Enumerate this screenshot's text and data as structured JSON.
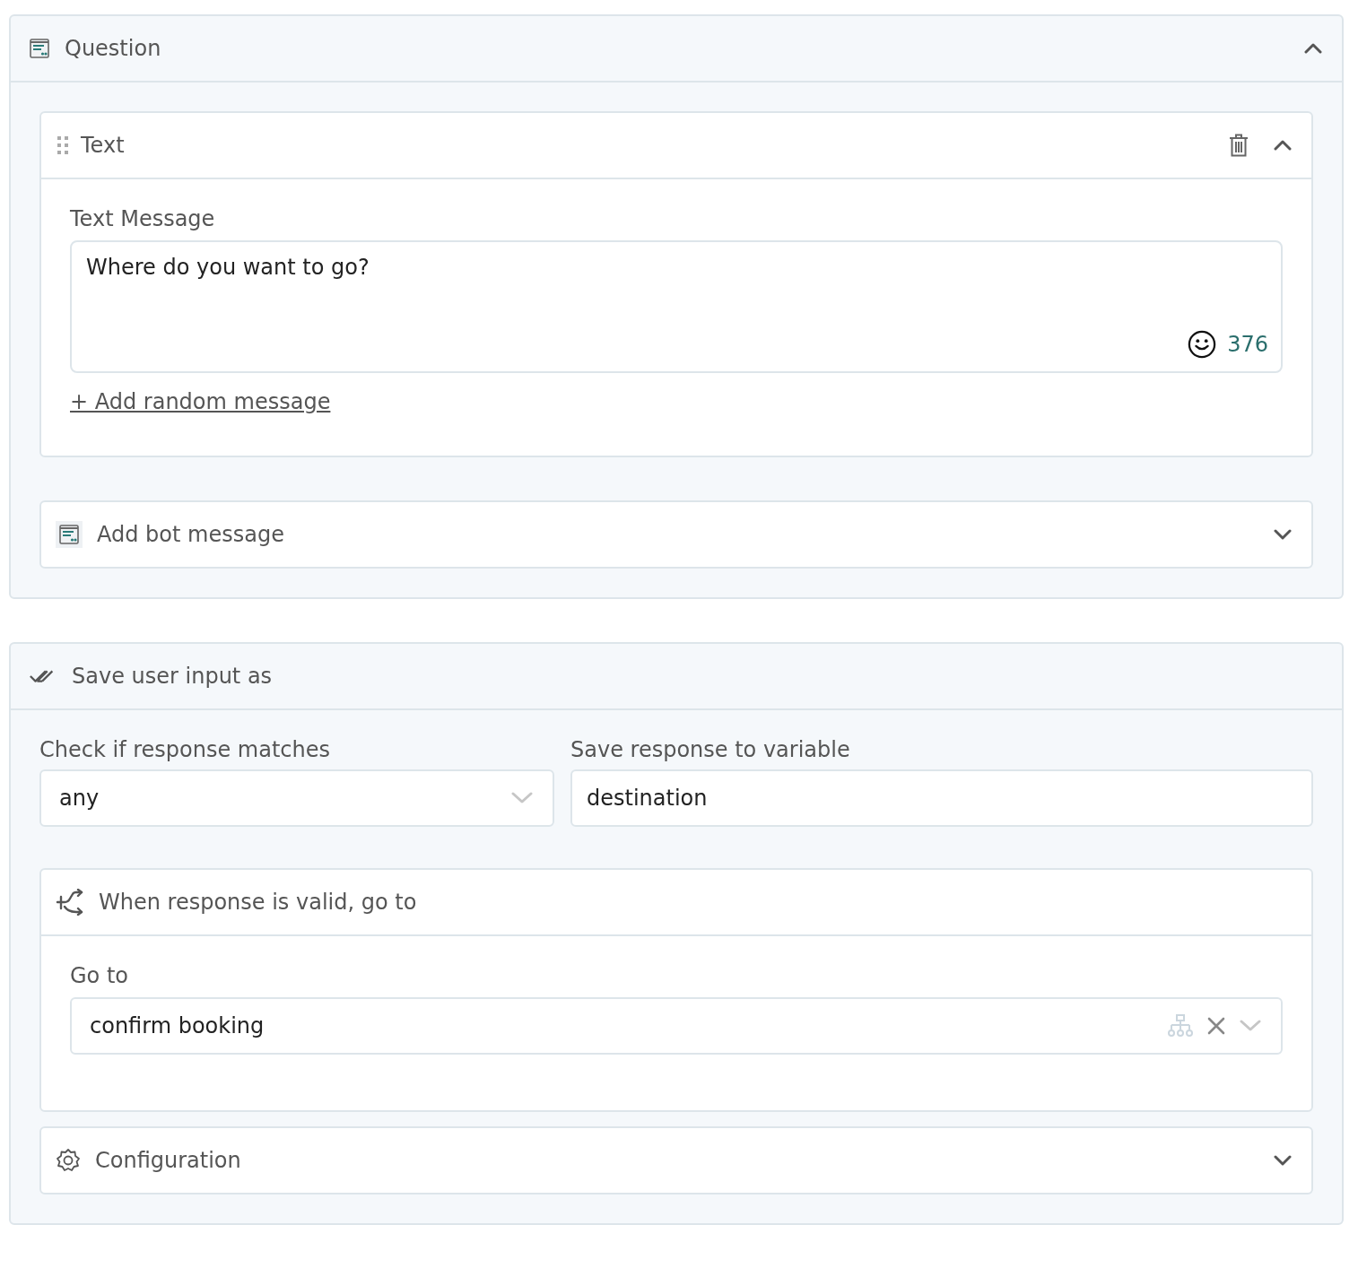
{
  "question": {
    "title": "Question",
    "expanded": true,
    "blocks": [
      {
        "title": "Text",
        "expanded": true,
        "label": "Text Message",
        "value": "Where do you want to go?",
        "counter": "376",
        "link": "+ Add random message"
      }
    ],
    "add_block": {
      "title": "Add bot message",
      "expanded": false
    }
  },
  "save_input": {
    "title": "Save user input as",
    "match": {
      "label": "Check if response matches",
      "value": "any"
    },
    "variable": {
      "label": "Save response to variable",
      "value": "destination"
    },
    "valid": {
      "title": "When response is valid, go to",
      "expanded": true,
      "label": "Go to",
      "value": "confirm booking"
    },
    "configuration": {
      "title": "Configuration",
      "expanded": false
    }
  }
}
